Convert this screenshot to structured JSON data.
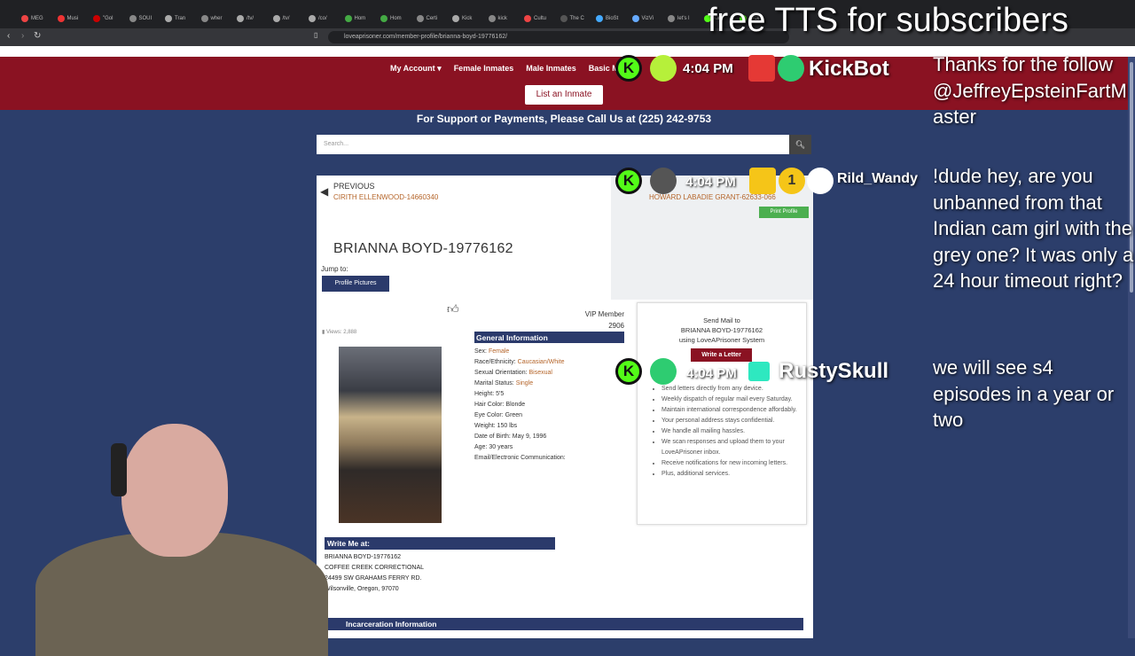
{
  "browser": {
    "tabs": [
      "MEG",
      "Musi",
      "\"Gol",
      "SOUI",
      "Tran",
      "wher",
      "/tv/",
      "/tv/",
      "/co/",
      "Hom",
      "Hom",
      "Certi",
      "Kick",
      "kick",
      "Cultu",
      "The C",
      "BioSt",
      "VizVi",
      "let's l",
      "Kick",
      "Kick"
    ],
    "url": "loveaprisoner.com/member-profile/brianna-boyd-19776162/"
  },
  "site": {
    "nav": [
      "My Account ▾",
      "Female Inmates",
      "Male Inmates",
      "Basic M"
    ],
    "list_button": "List an Inmate",
    "support": "For Support or Payments, Please Call Us at (225) 242-9753",
    "search_placeholder": "Search...",
    "prev_label": "PREVIOUS",
    "prev_name": "CIRITH ELLENWOOD-14660340",
    "next_name": "HOWARD LABADIE GRANT-62633-066",
    "print_button": "Print Profile",
    "profile_name": "BRIANNA BOYD-19776162",
    "jump_to": "Jump to:",
    "profile_pictures_button": "Profile Pictures",
    "vip_line1": "VIP Member",
    "vip_line2": "2906",
    "views": "Views: 2,888",
    "general_info_title": "General Information",
    "info": {
      "sex_label": "Sex: ",
      "sex": "Female",
      "race_label": "Race/Ethnicity: ",
      "race": "Caucasian/White",
      "orientation_label": "Sexual Orientation: ",
      "orientation": "Bisexual",
      "marital_label": "Marital Status: ",
      "marital": "Single",
      "height": "Height: 5'5",
      "hair": "Hair Color: Blonde",
      "eye": "Eye Color: Green",
      "weight": "Weight: 150 lbs",
      "dob": "Date of Birth: May 9, 1996",
      "age": "Age: 30 years",
      "email": "Email/Electronic Communication:"
    },
    "mail": {
      "line1": "Send Mail to",
      "line2": "BRIANNA BOYD-19776162",
      "line3": "using LoveAPrisoner System",
      "write_button": "Write a Letter",
      "items": [
        "Send letters directly from any device.",
        "Weekly dispatch of regular mail every Saturday.",
        "Maintain international correspondence affordably.",
        "Your personal address stays confidential.",
        "We handle all mailing hassles.",
        "We scan responses and upload them to your LoveAPrisoner inbox.",
        "Receive notifications for new incoming letters.",
        "Plus, additional services."
      ]
    },
    "write_me_title": "Write Me at:",
    "address": [
      "BRIANNA BOYD-19776162",
      "COFFEE CREEK CORRECTIONAL",
      "24499 SW GRAHAMS FERRY RD.",
      "Wilsonville, Oregon, 97070"
    ],
    "incarceration_title": "Incarceration Information"
  },
  "overlay": {
    "title": "free TTS for subscribers",
    "chat": [
      "Thanks for the follow @JeffreyEpsteinFartMaster",
      "!dude hey, are you unbanned from that Indian cam girl with the grey one? It was only a 24 hour timeout right?",
      "we will see s4 episodes in a year or two"
    ],
    "notifications": [
      {
        "time": "4:04 PM",
        "user": "KickBot"
      },
      {
        "time": "4:04 PM",
        "user": "Rild_Wandy",
        "badge": "1"
      },
      {
        "time": "4:04 PM",
        "user": "RustySkull"
      }
    ]
  }
}
